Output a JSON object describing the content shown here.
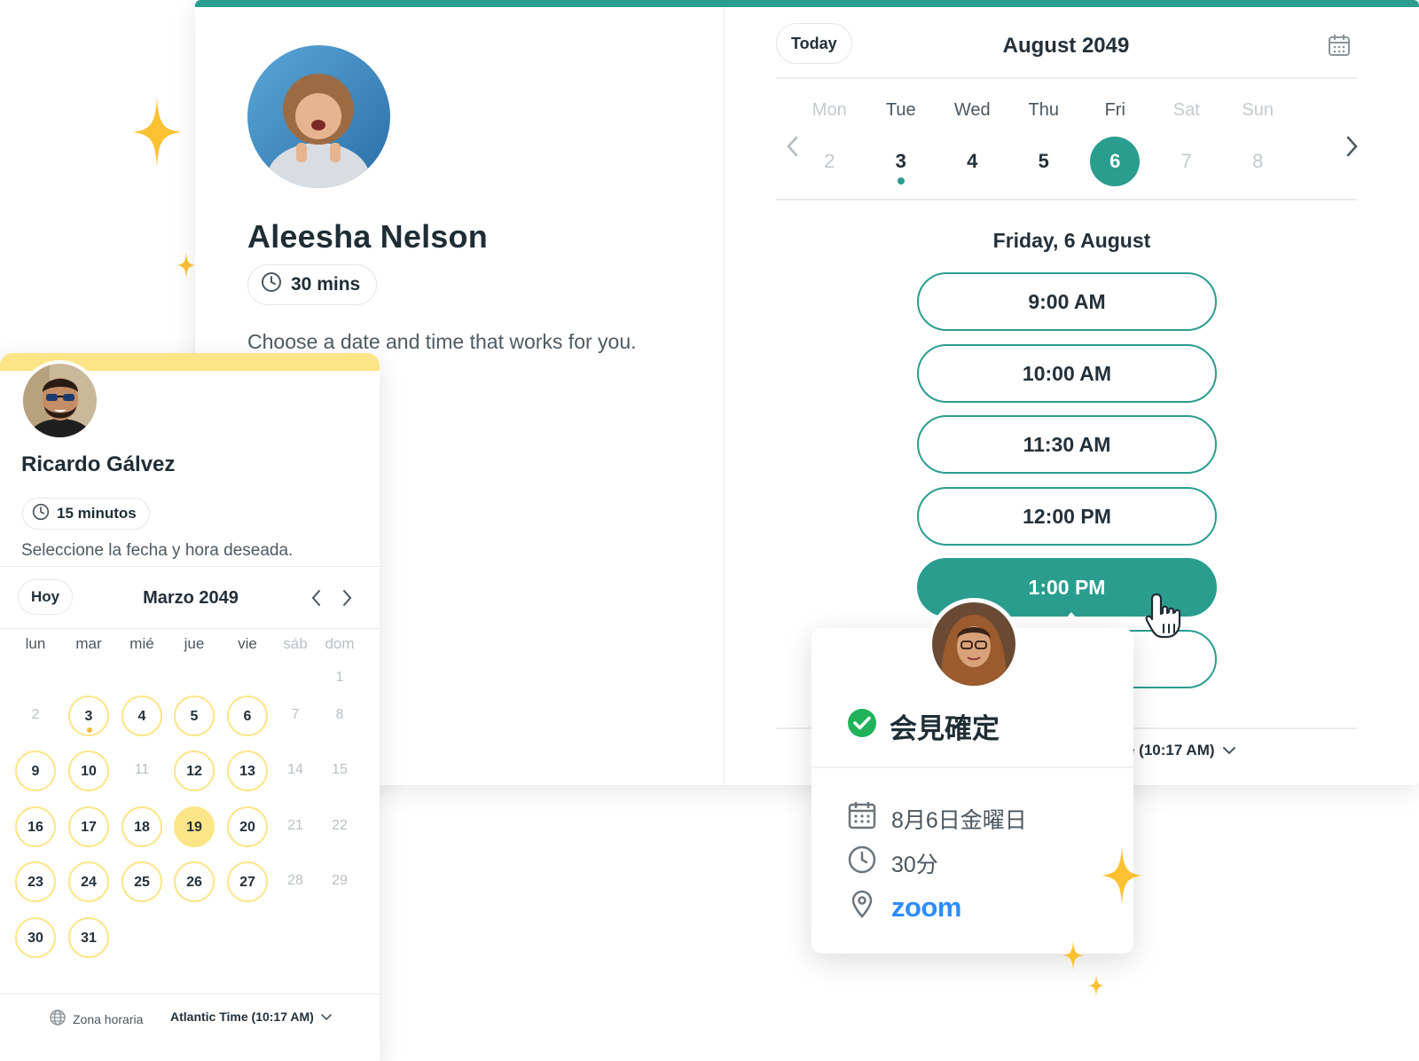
{
  "main": {
    "host_name": "Aleesha Nelson",
    "duration": "30 mins",
    "subtitle": "Choose a date and time that works for you.",
    "today_label": "Today",
    "month_title": "August 2049",
    "week": [
      {
        "name": "Mon",
        "num": "2",
        "state": "disabled"
      },
      {
        "name": "Tue",
        "num": "3",
        "state": "today"
      },
      {
        "name": "Wed",
        "num": "4",
        "state": "available"
      },
      {
        "name": "Thu",
        "num": "5",
        "state": "available"
      },
      {
        "name": "Fri",
        "num": "6",
        "state": "selected"
      },
      {
        "name": "Sat",
        "num": "7",
        "state": "disabled"
      },
      {
        "name": "Sun",
        "num": "8",
        "state": "disabled"
      }
    ],
    "day_heading": "Friday, 6 August",
    "slots": [
      "9:00 AM",
      "10:00 AM",
      "11:30 AM",
      "12:00 PM",
      "1:00 PM"
    ],
    "selected_slot": "1:00 PM",
    "timezone_partial": "e (10:17 AM)",
    "accent_color": "#2a9d8f"
  },
  "es": {
    "host_name": "Ricardo Gálvez",
    "duration": "15 minutos",
    "subtitle": "Seleccione la fecha y hora deseada.",
    "today_label": "Hoy",
    "month_title": "Marzo 2049",
    "weekdays": [
      "lun",
      "mar",
      "mié",
      "jue",
      "vie",
      "sáb",
      "dom"
    ],
    "days": [
      [
        "",
        "",
        "",
        "",
        "",
        "",
        "1"
      ],
      [
        "2",
        "3",
        "4",
        "5",
        "6",
        "7",
        "8"
      ],
      [
        "9",
        "10",
        "11",
        "12",
        "13",
        "14",
        "15"
      ],
      [
        "16",
        "17",
        "18",
        "19",
        "20",
        "21",
        "22"
      ],
      [
        "23",
        "24",
        "25",
        "26",
        "27",
        "28",
        "29"
      ],
      [
        "30",
        "31",
        "",
        "",
        "",
        "",
        ""
      ]
    ],
    "available": [
      "3",
      "4",
      "5",
      "6",
      "9",
      "10",
      "12",
      "13",
      "16",
      "17",
      "18",
      "19",
      "20",
      "23",
      "24",
      "25",
      "26",
      "27",
      "30",
      "31"
    ],
    "selected": "19",
    "today": "3",
    "timezone_label": "Zona horaria",
    "timezone_value": "Atlantic Time (10:17 AM)",
    "accent_color": "#fce587"
  },
  "popover": {
    "title": "会見確定",
    "date": "8月6日金曜日",
    "duration": "30分",
    "location": "zoom",
    "location_color": "#2d8cff",
    "check_color": "#1fb25a"
  },
  "icons": [
    "sparkle-icon",
    "clock-icon",
    "calendar-icon",
    "chevron-left-icon",
    "chevron-right-icon",
    "chevron-down-icon",
    "globe-icon",
    "check-circle-icon",
    "map-pin-icon",
    "hand-cursor-icon"
  ]
}
